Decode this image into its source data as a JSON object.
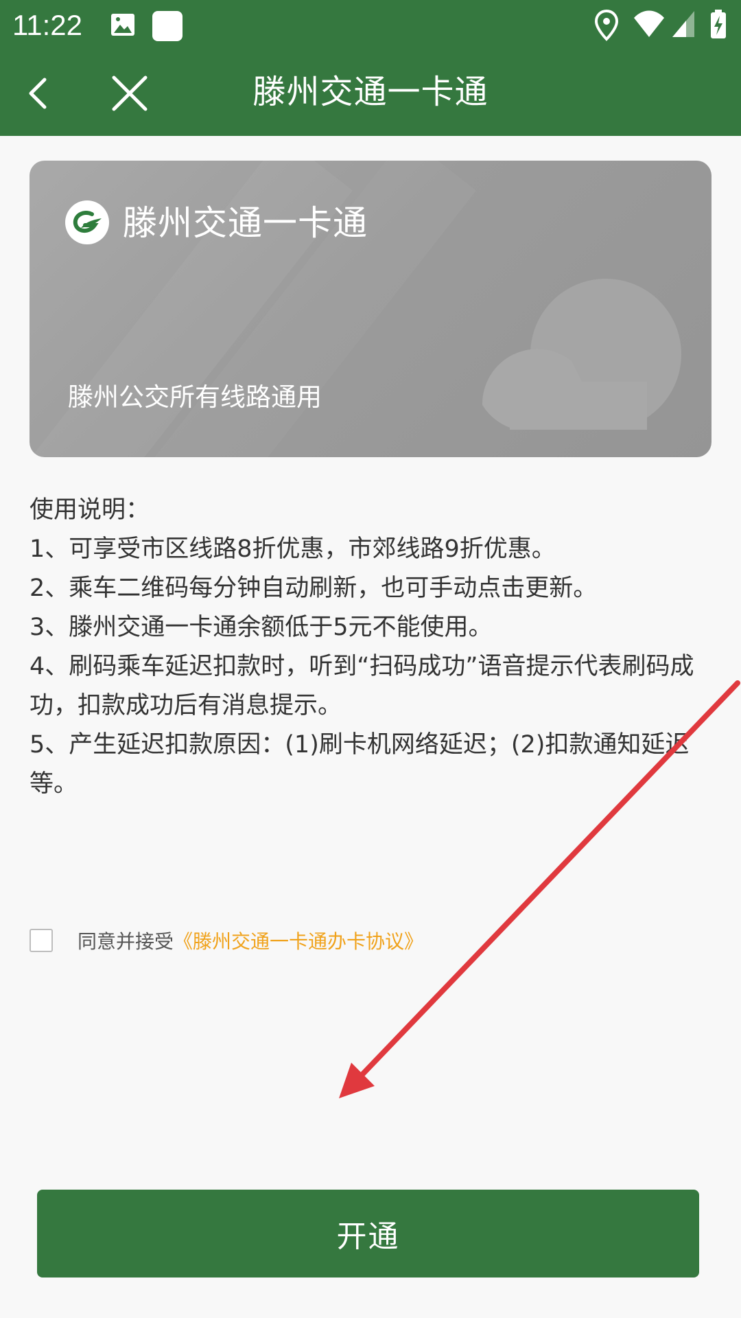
{
  "status_bar": {
    "time": "11:22",
    "icons": [
      "image-notification-icon",
      "app-notification-icon",
      "location-icon",
      "wifi-icon",
      "cell-signal-icon",
      "battery-charging-icon"
    ]
  },
  "app_bar": {
    "back_icon": "chevron-left-icon",
    "close_icon": "close-icon",
    "title": "滕州交通一卡通"
  },
  "card": {
    "logo_icon": "transit-logo-icon",
    "title": "滕州交通一卡通",
    "subtitle": "滕州公交所有线路通用",
    "background_color": "#a0a0a0"
  },
  "instructions": {
    "heading": "使用说明：",
    "items": [
      "1、可享受市区线路8折优惠，市郊线路9折优惠。",
      "2、乘车二维码每分钟自动刷新，也可手动点击更新。",
      "3、滕州交通一卡通余额低于5元不能使用。",
      "4、刷码乘车延迟扣款时，听到“扫码成功”语音提示代表刷码成功，扣款成功后有消息提示。",
      "5、产生延迟扣款原因：(1)刷卡机网络延迟；(2)扣款通知延迟等。"
    ]
  },
  "agreement": {
    "checked": false,
    "text": "同意并接受",
    "link_text": "《滕州交通一卡通办卡协议》",
    "link_color": "#f0a21b"
  },
  "open_button": {
    "label": "开通"
  },
  "colors": {
    "primary": "#35783f",
    "background": "#f8f8f8",
    "annotation_arrow": "#e0393e"
  }
}
